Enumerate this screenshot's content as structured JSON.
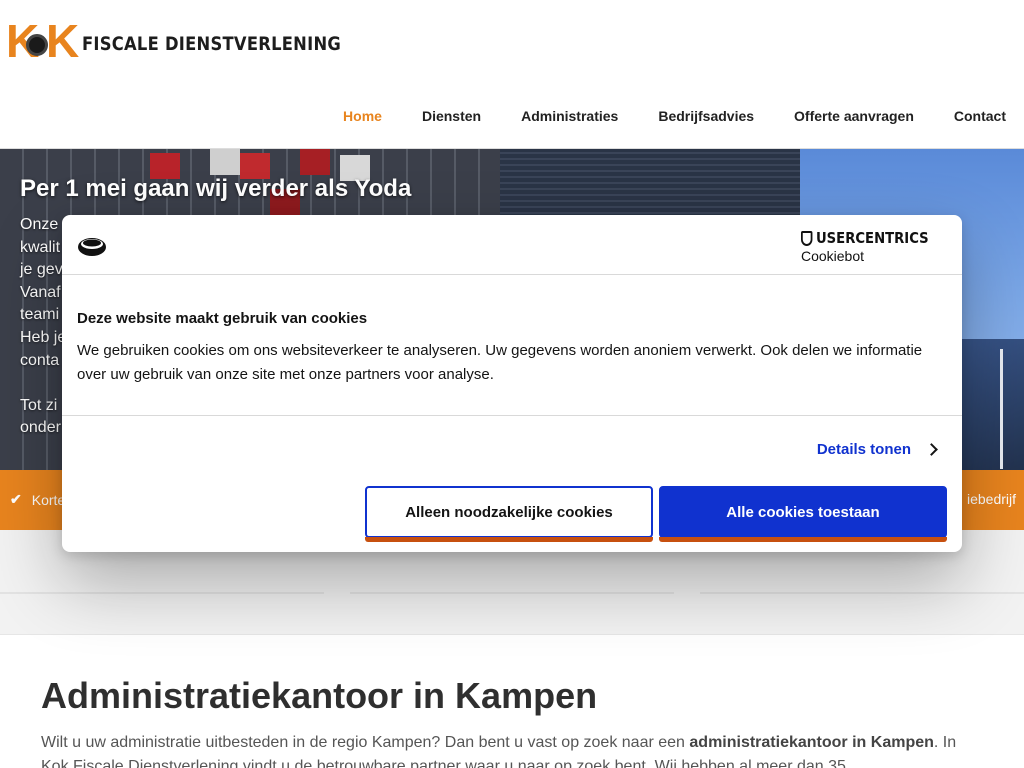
{
  "header": {
    "logo": {
      "letters": [
        "K",
        "K"
      ],
      "text": "FISCALE DIENSTVERLENING"
    },
    "nav": [
      {
        "label": "Home",
        "active": true
      },
      {
        "label": "Diensten",
        "active": false
      },
      {
        "label": "Administraties",
        "active": false
      },
      {
        "label": "Bedrijfsadvies",
        "active": false
      },
      {
        "label": "Offerte aanvragen",
        "active": false
      },
      {
        "label": "Contact",
        "active": false
      }
    ]
  },
  "hero": {
    "title": "Per 1 mei gaan wij verder als Yoda",
    "text_fragments": "Onze\nkwalit\nje gev\nVanaf\nteami\nHeb je\nconta\n\nTot zi\nonder"
  },
  "usp_bar": {
    "left_icon": "check-icon",
    "left_text": "Korte",
    "right_text": "iebedrijf"
  },
  "content": {
    "heading": "Administratiekantoor in Kampen",
    "paragraph_start": "Wilt u uw administratie uitbesteden in de regio Kampen? Dan bent u vast op zoek naar een ",
    "paragraph_bold": "administratiekantoor in Kampen",
    "paragraph_end": ". In Kok Fiscale Dienstverlening vindt u de betrouwbare partner waar u naar op zoek bent. Wij hebben al meer dan 35"
  },
  "cookie_dialog": {
    "brand_top": "USERCENTRICS",
    "brand_bottom": "Cookiebot",
    "title": "Deze website maakt gebruik van cookies",
    "text": "We gebruiken cookies om ons websiteverkeer te analyseren. Uw gegevens worden anoniem verwerkt. Ook delen we informatie over uw gebruik van onze site met onze partners voor analyse.",
    "details_label": "Details tonen",
    "btn_necessary": "Alleen noodzakelijke cookies",
    "btn_all": "Alle cookies toestaan"
  },
  "colors": {
    "accent_orange": "#e8841e",
    "cookie_blue": "#1032cf",
    "button_underline": "#c7500f"
  }
}
